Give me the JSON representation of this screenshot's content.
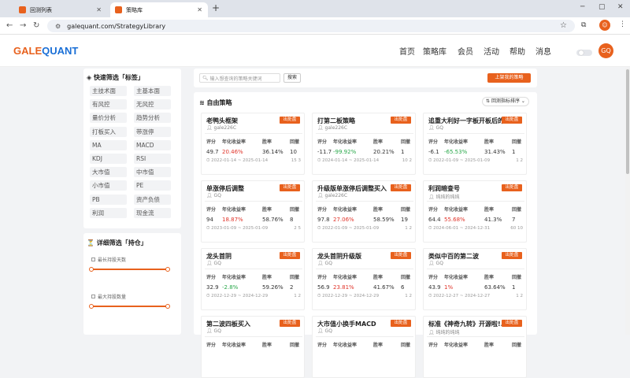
{
  "browser": {
    "tabs": [
      {
        "title": "回测列表"
      },
      {
        "title": "策略库"
      }
    ],
    "url": "galequant.com/StrategyLibrary"
  },
  "site": {
    "logo_part1": "GALE",
    "logo_part2": "QUANT",
    "nav": [
      "首页",
      "策略库",
      "会员",
      "活动",
      "帮助",
      "消息"
    ],
    "avatar": "GQ"
  },
  "quick_filter": {
    "title": "快速筛选「标签」",
    "tags": [
      "主技术面",
      "主基本面",
      "有风控",
      "无风控",
      "量价分析",
      "趋势分析",
      "打板买入",
      "带涨停",
      "MA",
      "MACD",
      "KDJ",
      "RSI",
      "大市值",
      "中市值",
      "小市值",
      "PE",
      "PB",
      "资产负债",
      "利润",
      "现金流"
    ]
  },
  "detail_filter": {
    "title": "详细筛选「持仓」",
    "sliders": [
      {
        "label": "最长持股天数",
        "low": 0,
        "high": 1
      },
      {
        "label": "最大持股数量",
        "low": 0,
        "high": 1
      }
    ]
  },
  "toolbar": {
    "search_placeholder": "输入想查询的策略关键词",
    "search_button": "搜索",
    "upload_button": "上架我的策略"
  },
  "list": {
    "title": "自由策略",
    "sort_label": "回测指标排序",
    "col_headers": [
      "评分",
      "年化收益率",
      "胜率",
      "回撤"
    ],
    "badge": "出处盘",
    "strategies": [
      {
        "name": "老鸭头框架",
        "author": "gale226C",
        "score": "49.7",
        "annual": "20.46%",
        "annual_color": "red",
        "win": "36.14%",
        "dd": "10",
        "dates": "2022-01-14 ~ 2025-01-14",
        "comments": "15 3"
      },
      {
        "name": "打第二板策略",
        "author": "gale226C",
        "score": "-11.7",
        "annual": "-99.92%",
        "annual_color": "green",
        "win": "20.21%",
        "dd": "1",
        "dates": "2024-01-14 ~ 2025-01-14",
        "comments": "10 2"
      },
      {
        "name": "追重大利好一字板开板后的...",
        "author": "GQ",
        "score": "-6.1",
        "annual": "-65.53%",
        "annual_color": "green",
        "win": "31.43%",
        "dd": "1",
        "dates": "2022-01-09 ~ 2025-01-09",
        "comments": "1 2"
      },
      {
        "name": "单涨停后调整",
        "author": "GQ",
        "score": "94",
        "annual": "18.87%",
        "annual_color": "red",
        "win": "58.76%",
        "dd": "8",
        "dates": "2023-01-09 ~ 2025-01-09",
        "comments": "2 5"
      },
      {
        "name": "升级版单涨停后调整买入",
        "author": "gale226C",
        "score": "97.8",
        "annual": "27.06%",
        "annual_color": "red",
        "win": "58.59%",
        "dd": "19",
        "dates": "2022-01-09 ~ 2025-01-09",
        "comments": "1 2"
      },
      {
        "name": "利润暗查号",
        "author": "纯纯的纯纯",
        "score": "64.4",
        "annual": "55.68%",
        "annual_color": "red",
        "win": "41.3%",
        "dd": "7",
        "dates": "2024-06-01 ~ 2024-12-31",
        "comments": "60 10"
      },
      {
        "name": "龙头首阴",
        "author": "GQ",
        "score": "32.9",
        "annual": "-2.8%",
        "annual_color": "green",
        "win": "59.26%",
        "dd": "2",
        "dates": "2022-12-29 ~ 2024-12-29",
        "comments": "1 2"
      },
      {
        "name": "龙头首阴升级版",
        "author": "GQ",
        "score": "56.9",
        "annual": "23.81%",
        "annual_color": "red",
        "win": "41.67%",
        "dd": "6",
        "dates": "2022-12-29 ~ 2024-12-29",
        "comments": "1 2"
      },
      {
        "name": "类似中百的第二波",
        "author": "GQ",
        "score": "43.9",
        "annual": "1%",
        "annual_color": "red",
        "win": "63.64%",
        "dd": "1",
        "dates": "2022-12-27 ~ 2024-12-27",
        "comments": "1 2"
      },
      {
        "name": "第二波四板买入",
        "author": "GQ",
        "score": "",
        "annual": "",
        "annual_color": "red",
        "win": "",
        "dd": "",
        "dates": "",
        "comments": ""
      },
      {
        "name": "大市值小换手MACD",
        "author": "GQ",
        "score": "",
        "annual": "",
        "annual_color": "red",
        "win": "",
        "dd": "",
        "dates": "",
        "comments": ""
      },
      {
        "name": "标准《神奇九转》开源啦!...",
        "author": "纯纯的纯纯",
        "score": "",
        "annual": "",
        "annual_color": "red",
        "win": "",
        "dd": "",
        "dates": "",
        "comments": ""
      }
    ]
  }
}
